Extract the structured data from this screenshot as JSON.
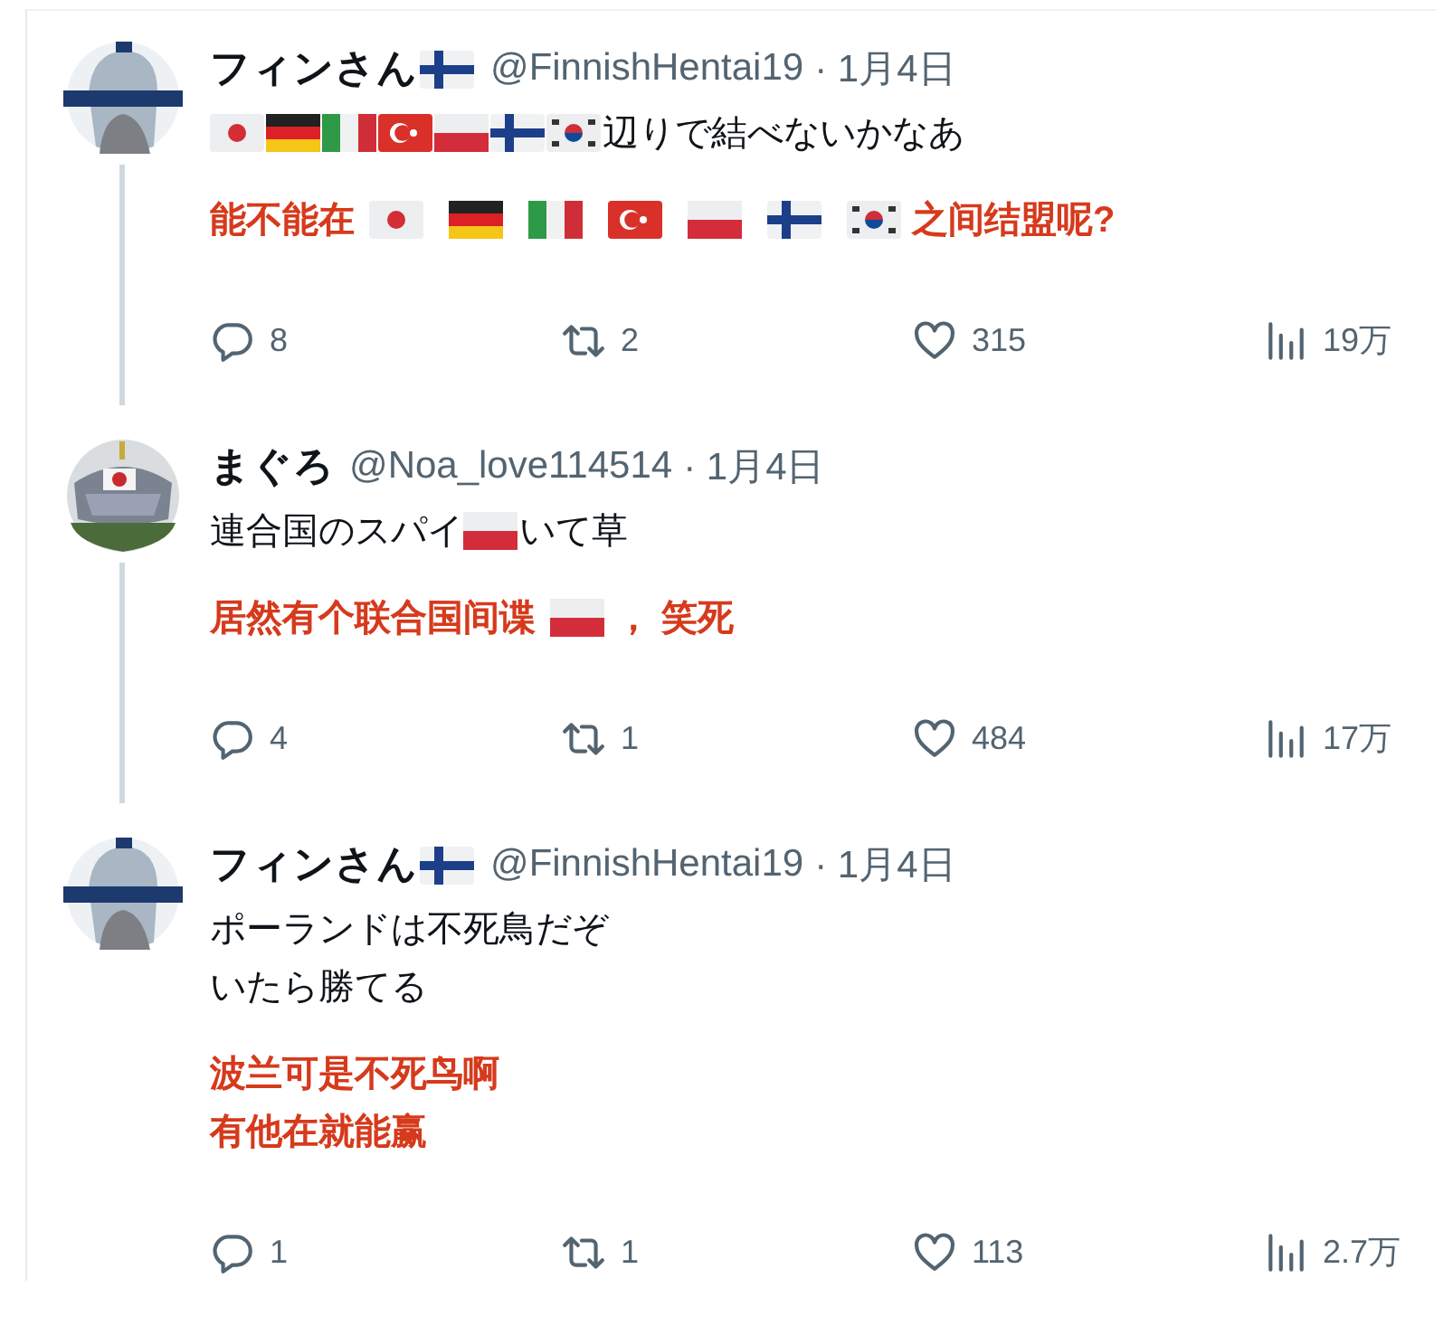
{
  "tweets": [
    {
      "avatar": {
        "kind": "portrait"
      },
      "name": [
        {
          "kind": "text",
          "text": "フィンさん"
        },
        {
          "kind": "fi"
        }
      ],
      "handle": "@FinnishHentai19",
      "date": "· 1月4日",
      "body": [
        [
          {
            "kind": "jp"
          },
          {
            "kind": "de"
          },
          {
            "kind": "it"
          },
          {
            "kind": "tr"
          },
          {
            "kind": "pl"
          },
          {
            "kind": "fi"
          },
          {
            "kind": "kr"
          },
          {
            "kind": "text",
            "text": "辺りで結べないかなあ"
          }
        ]
      ],
      "translation": [
        [
          {
            "kind": "text",
            "text": "能不能在"
          },
          {
            "kind": "jp"
          },
          {
            "kind": "de"
          },
          {
            "kind": "it"
          },
          {
            "kind": "tr"
          },
          {
            "kind": "pl"
          },
          {
            "kind": "fi"
          },
          {
            "kind": "kr"
          },
          {
            "kind": "text",
            "text": "之间结盟呢?"
          }
        ]
      ],
      "stats": [
        {
          "kind": "reply",
          "count": "8"
        },
        {
          "kind": "retweet",
          "count": "2"
        },
        {
          "kind": "like",
          "count": "315"
        },
        {
          "kind": "views",
          "count": "19万"
        }
      ]
    },
    {
      "avatar": {
        "kind": "helmet"
      },
      "name": [
        {
          "kind": "text",
          "text": "まぐろ"
        }
      ],
      "handle": "@Noa_love114514",
      "date": "· 1月4日",
      "body": [
        [
          {
            "kind": "text",
            "text": "連合国のスパイ"
          },
          {
            "kind": "pl"
          },
          {
            "kind": "text",
            "text": "いて草"
          }
        ]
      ],
      "translation": [
        [
          {
            "kind": "text",
            "text": "居然有个联合国间谍"
          },
          {
            "kind": "pl"
          },
          {
            "kind": "text",
            "text": "， 笑死"
          }
        ]
      ],
      "stats": [
        {
          "kind": "reply",
          "count": "4"
        },
        {
          "kind": "retweet",
          "count": "1"
        },
        {
          "kind": "like",
          "count": "484"
        },
        {
          "kind": "views",
          "count": "17万"
        }
      ]
    },
    {
      "avatar": {
        "kind": "portrait"
      },
      "name": [
        {
          "kind": "text",
          "text": "フィンさん"
        },
        {
          "kind": "fi"
        }
      ],
      "handle": "@FinnishHentai19",
      "date": "· 1月4日",
      "body": [
        [
          {
            "kind": "text",
            "text": "ポーランドは不死鳥だぞ"
          }
        ],
        [
          {
            "kind": "text",
            "text": "いたら勝てる"
          }
        ]
      ],
      "translation": [
        [
          {
            "kind": "text",
            "text": "波兰可是不死鸟啊"
          }
        ],
        [
          {
            "kind": "text",
            "text": "有他在就能赢"
          }
        ]
      ],
      "stats": [
        {
          "kind": "reply",
          "count": "1"
        },
        {
          "kind": "retweet",
          "count": "1"
        },
        {
          "kind": "like",
          "count": "113"
        },
        {
          "kind": "views",
          "count": "2.7万"
        }
      ]
    }
  ]
}
